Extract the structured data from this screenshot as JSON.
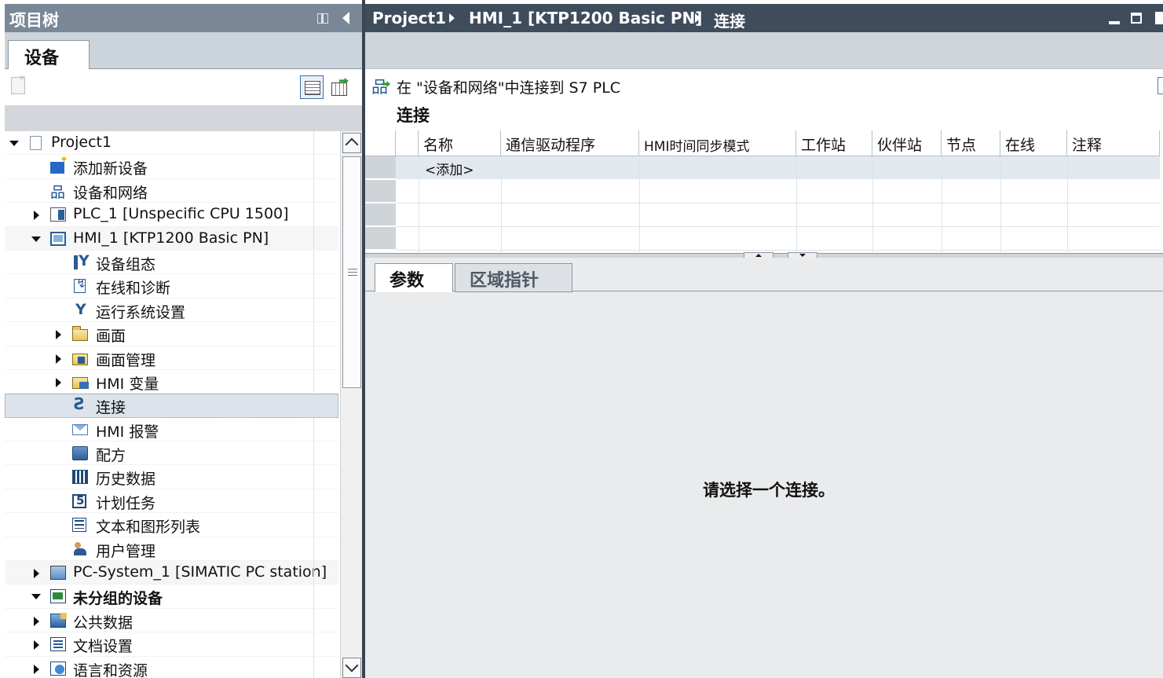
{
  "project_tree": {
    "title": "项目树",
    "tab_devices": "设备",
    "items": [
      {
        "label": "Project1",
        "icon": "project-icon"
      },
      {
        "label": "添加新设备",
        "icon": "add-device-icon"
      },
      {
        "label": "设备和网络",
        "icon": "network-icon"
      },
      {
        "label": "PLC_1 [Unspecific CPU 1500]",
        "icon": "plc-icon"
      },
      {
        "label": "HMI_1 [KTP1200 Basic PN]",
        "icon": "hmi-icon"
      },
      {
        "label": "设备组态",
        "icon": "device-config-icon"
      },
      {
        "label": "在线和诊断",
        "icon": "online-diagnostics-icon"
      },
      {
        "label": "运行系统设置",
        "icon": "runtime-settings-icon"
      },
      {
        "label": "画面",
        "icon": "folder-icon"
      },
      {
        "label": "画面管理",
        "icon": "screen-management-icon"
      },
      {
        "label": "HMI 变量",
        "icon": "hmi-tags-icon"
      },
      {
        "label": "连接",
        "icon": "connections-icon"
      },
      {
        "label": "HMI 报警",
        "icon": "alarm-icon"
      },
      {
        "label": "配方",
        "icon": "recipe-icon"
      },
      {
        "label": "历史数据",
        "icon": "historical-data-icon"
      },
      {
        "label": "计划任务",
        "icon": "scheduled-task-icon"
      },
      {
        "label": "文本和图形列表",
        "icon": "text-graphic-list-icon"
      },
      {
        "label": "用户管理",
        "icon": "user-management-icon"
      },
      {
        "label": "PC-System_1 [SIMATIC PC station]",
        "icon": "pc-station-icon"
      },
      {
        "label": "未分组的设备",
        "icon": "ungrouped-devices-icon"
      },
      {
        "label": "公共数据",
        "icon": "common-data-icon"
      },
      {
        "label": "文档设置",
        "icon": "document-settings-icon"
      },
      {
        "label": "语言和资源",
        "icon": "languages-icon"
      }
    ]
  },
  "breadcrumb": [
    "Project1",
    "HMI_1 [KTP1200 Basic PN]",
    "连接"
  ],
  "editor": {
    "network_link": "在 \"设备和网络\"中连接到 S7 PLC",
    "section_title": "连接",
    "columns": [
      "名称",
      "通信驱动程序",
      "HMI时间同步模式",
      "工作站",
      "伙伴站",
      "节点",
      "在线",
      "注释"
    ],
    "add_row": "<添加>",
    "tabs": [
      "参数",
      "区域指针"
    ],
    "empty_message": "请选择一个连接。"
  },
  "colors": {
    "tree_title_bar": "#7a8797",
    "editor_title_bar": "#3f4c5c",
    "selection": "#dde3ea"
  }
}
